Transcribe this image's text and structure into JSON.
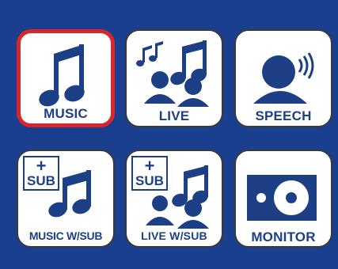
{
  "colors": {
    "background": "#1a3f8f",
    "tile": "#ffffff",
    "icon": "#1d3f86",
    "selected_border": "#d9262a"
  },
  "tiles": [
    {
      "label": "MUSIC",
      "icon": "music-note-icon",
      "selected": true
    },
    {
      "label": "LIVE",
      "icon": "live-audience-icon",
      "selected": false
    },
    {
      "label": "SPEECH",
      "icon": "speaker-person-icon",
      "selected": false
    },
    {
      "label": "MUSIC W/SUB",
      "icon": "music-note-icon",
      "selected": false,
      "badge": {
        "plus": "+",
        "text": "SUB"
      }
    },
    {
      "label": "LIVE W/SUB",
      "icon": "live-audience-icon",
      "selected": false,
      "badge": {
        "plus": "+",
        "text": "SUB"
      }
    },
    {
      "label": "MONITOR",
      "icon": "monitor-speaker-icon",
      "selected": false
    }
  ]
}
